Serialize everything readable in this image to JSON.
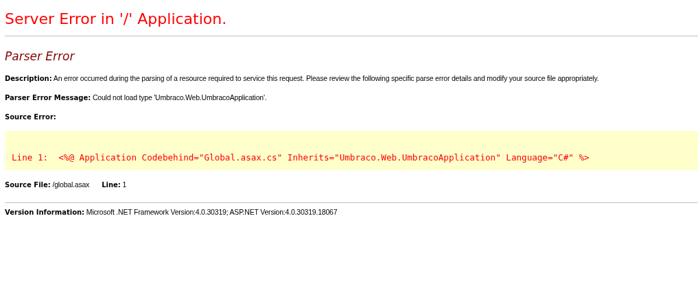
{
  "title": "Server Error in '/' Application.",
  "subtitle": "Parser Error",
  "details": [
    {
      "label": "Description:",
      "value": "An error occurred during the parsing of a resource required to service this request. Please review the following specific parse error details and modify your source file appropriately."
    },
    {
      "label": "Parser Error Message:",
      "value": "Could not load type 'Umbraco.Web.UmbracoApplication'."
    },
    {
      "label": "Source Error:"
    }
  ],
  "source_code": [
    {
      "line": "Line 1:",
      "code": "<%@ Application Codebehind=\"Global.asax.cs\" Inherits=\"Umbraco.Web.UmbracoApplication\" Language=\"C#\" %>"
    }
  ],
  "source_location": [
    {
      "label": "Source File:",
      "value": "/global.asax"
    },
    {
      "label": "Line:",
      "value": "1"
    }
  ],
  "version": {
    "label": "Version Information:",
    "value": "Microsoft .NET Framework Version:4.0.30319; ASP.NET Version:4.0.30319.18067"
  }
}
